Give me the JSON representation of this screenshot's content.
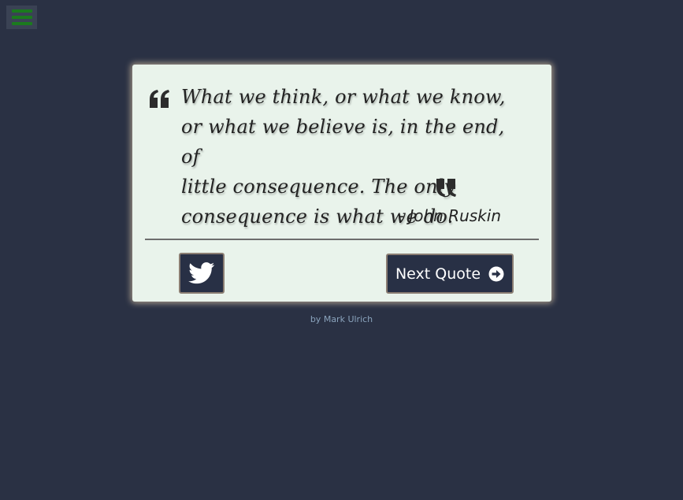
{
  "menu": {
    "icon": "hamburger-menu-icon",
    "color": "#1b7a1e"
  },
  "quote": {
    "lines": [
      "What we think, or what we know,",
      "or what we believe is, in the end, of",
      "little consequence. The only",
      "consequence is what we do."
    ],
    "author": "- John Ruskin",
    "open_icon": "quote-left-icon",
    "close_icon": "quote-right-icon"
  },
  "actions": {
    "tweet_icon": "twitter-icon",
    "next_label": "Next Quote",
    "next_icon": "arrow-circle-right-icon"
  },
  "footer": {
    "prefix": "by",
    "author_link": "Mark Ulrich"
  },
  "colors": {
    "background": "#2a3144",
    "card": "#e9f3eb",
    "button": "#283045",
    "accent_green": "#1b7a1e",
    "credit": "#8aa3bc"
  }
}
